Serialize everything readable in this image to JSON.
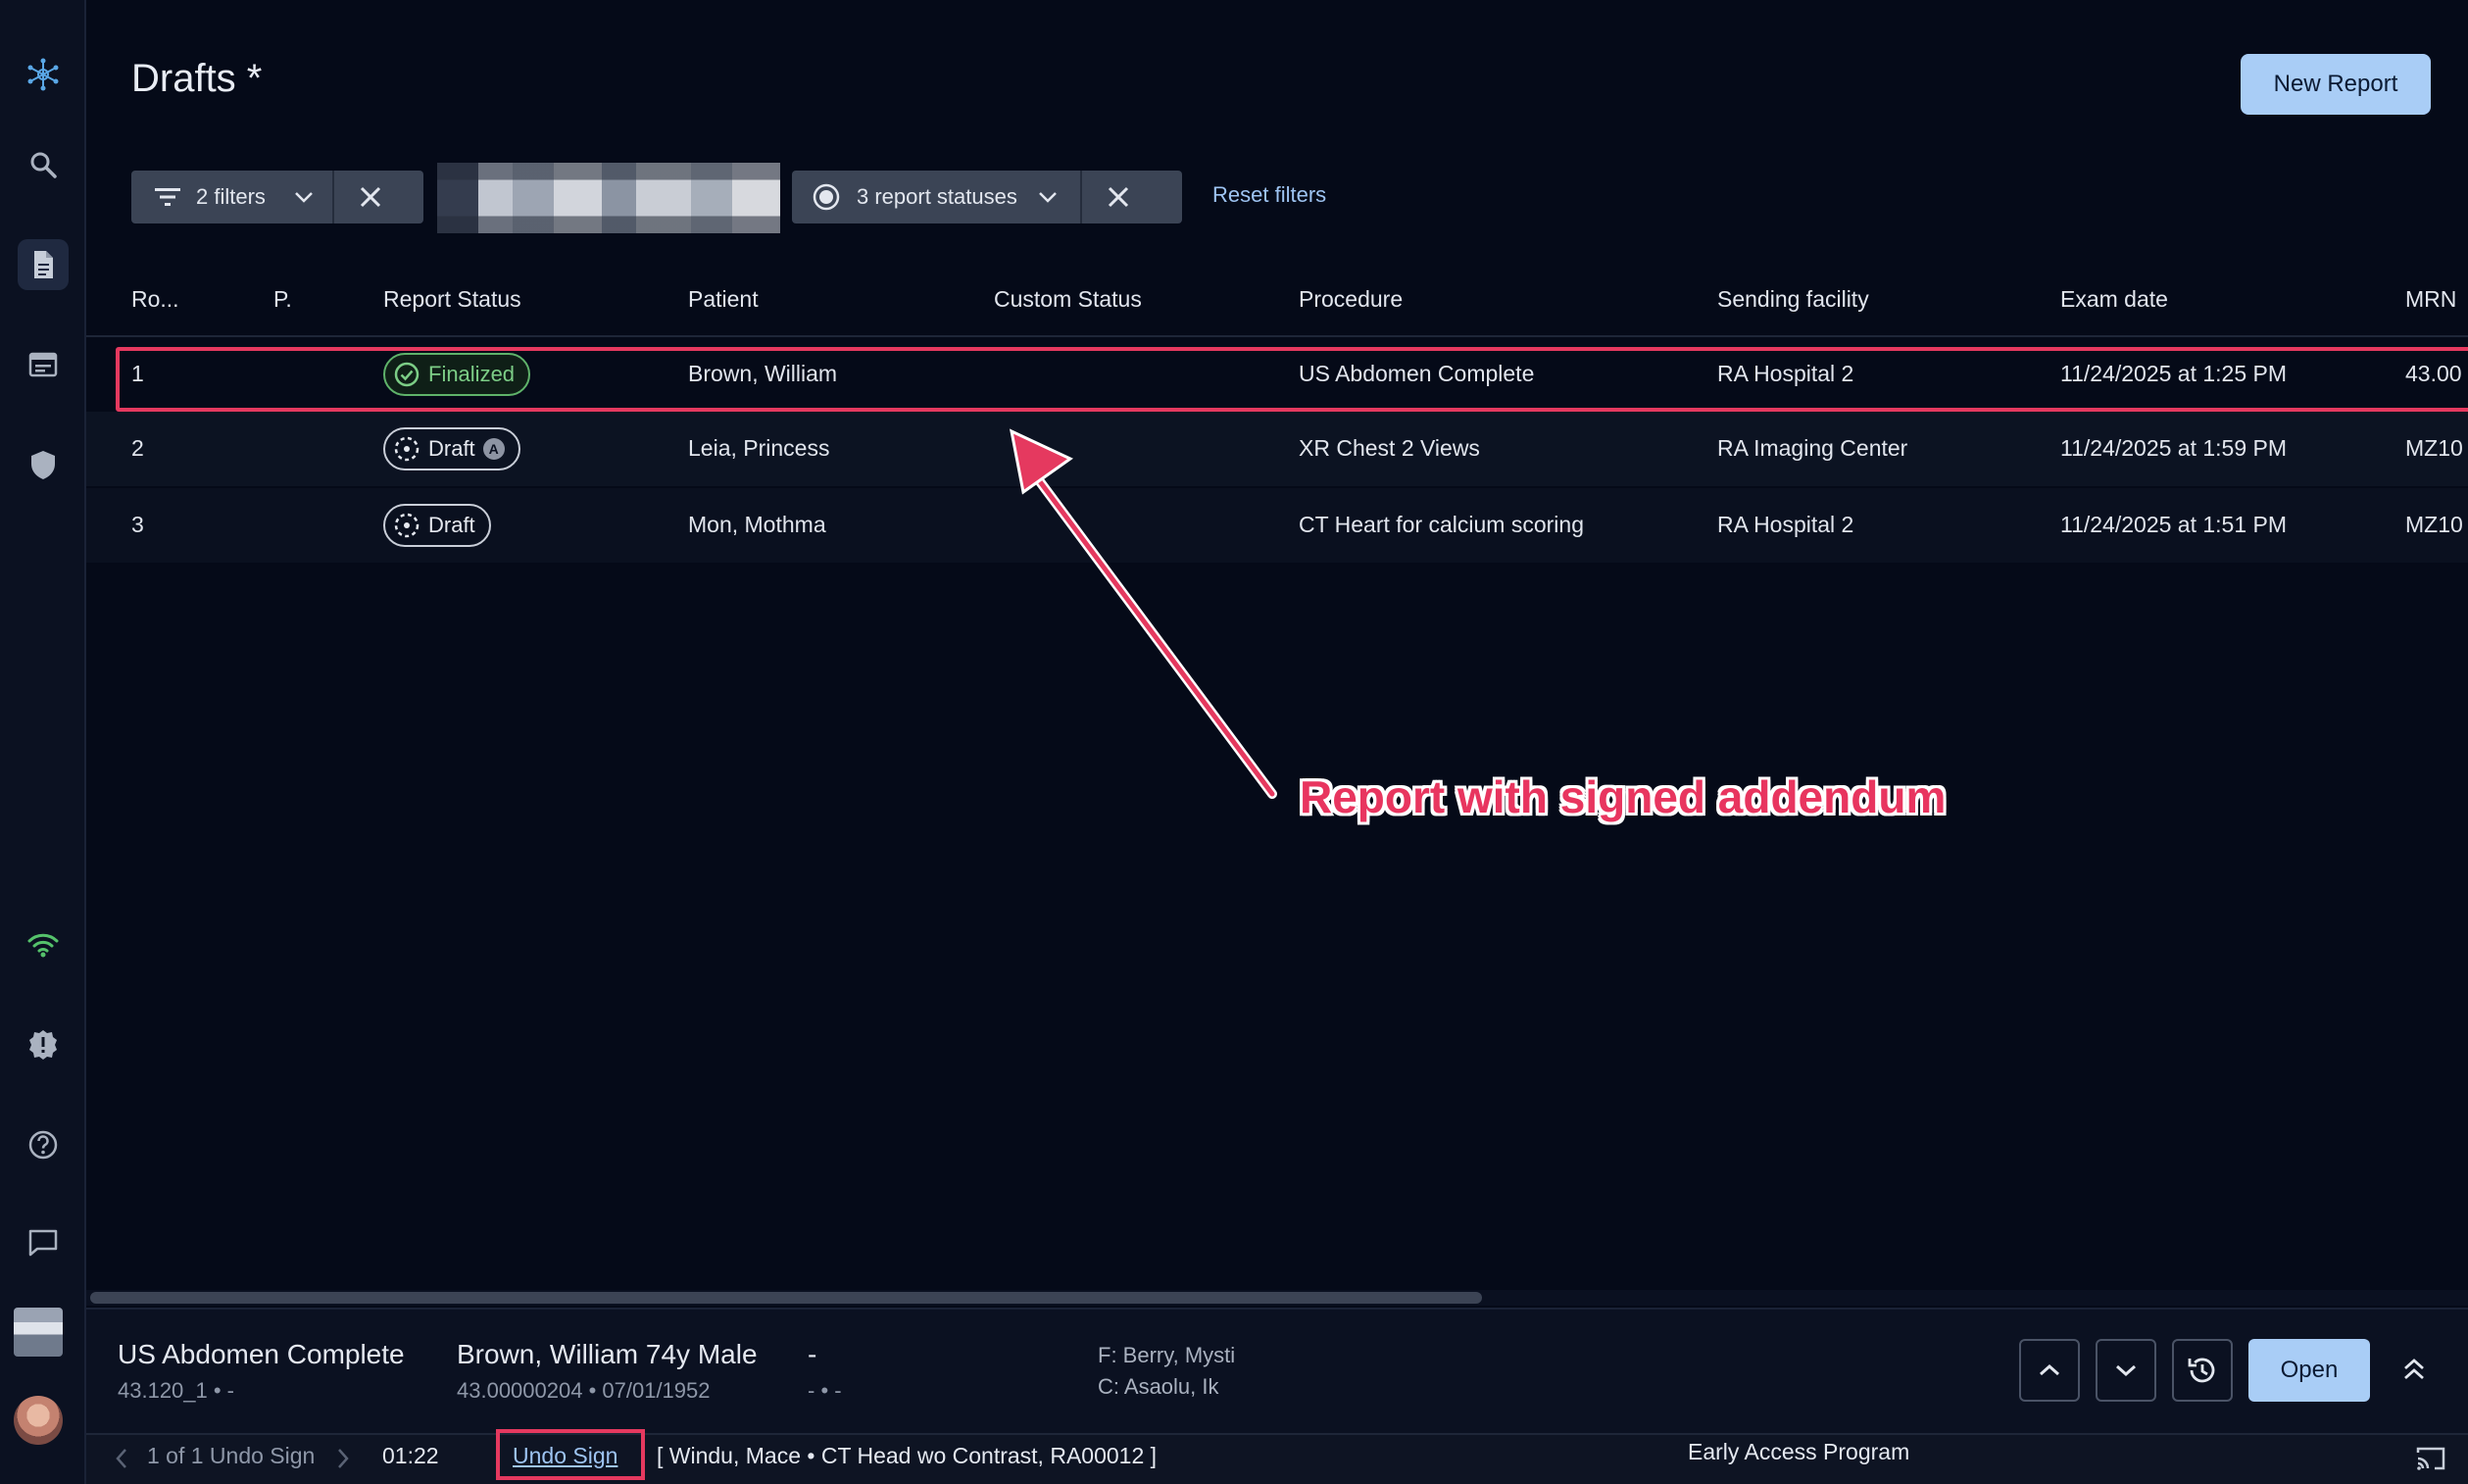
{
  "page": {
    "title": "Drafts *"
  },
  "header": {
    "new_report_label": "New Report"
  },
  "filters": {
    "filter_chip_label": "2 filters",
    "status_chip_label": "3 report statuses",
    "reset_label": "Reset filters"
  },
  "table": {
    "columns": [
      "Ro...",
      "P.",
      "Report Status",
      "Patient",
      "Custom Status",
      "Procedure",
      "Sending facility",
      "Exam date",
      "MRN"
    ],
    "rows": [
      {
        "row": "1",
        "status": "Finalized",
        "patient": "Brown, William",
        "custom_status": "",
        "procedure": "US Abdomen Complete",
        "facility": "RA Hospital 2",
        "exam_date": "11/24/2025 at 1:25 PM",
        "mrn": "43.00"
      },
      {
        "row": "2",
        "status": "Draft",
        "status_mark": "A",
        "patient": "Leia, Princess",
        "custom_status": "",
        "procedure": "XR Chest 2 Views",
        "facility": "RA Imaging Center",
        "exam_date": "11/24/2025 at 1:59 PM",
        "mrn": "MZ10"
      },
      {
        "row": "3",
        "status": "Draft",
        "patient": "Mon, Mothma",
        "custom_status": "",
        "procedure": "CT Heart for calcium scoring",
        "facility": "RA Hospital 2",
        "exam_date": "11/24/2025 at 1:51 PM",
        "mrn": "MZ10"
      }
    ]
  },
  "annotation": {
    "text": "Report with signed addendum"
  },
  "bottom_panel": {
    "procedure": "US Abdomen Complete",
    "procedure_sub": "43.120_1 • -",
    "patient": "Brown, William 74y Male",
    "patient_sub": "43.00000204 • 07/01/1952",
    "dash": "-",
    "dash_sub": "- • -",
    "f_line": "F: Berry, Mysti",
    "c_line": "C: Asaolu, Ik",
    "open_label": "Open"
  },
  "status_bar": {
    "pager": "1 of 1 Undo Sign",
    "timer": "01:22",
    "undo_label": "Undo Sign",
    "context": "[ Windu, Mace • CT Head wo Contrast, RA00012 ]",
    "program": "Early Access Program"
  },
  "colors": {
    "background": "#050a18",
    "accent": "#a9cdf6",
    "highlight": "#e5395f",
    "finalized": "#5fb36a",
    "link": "#9ec4f2"
  }
}
